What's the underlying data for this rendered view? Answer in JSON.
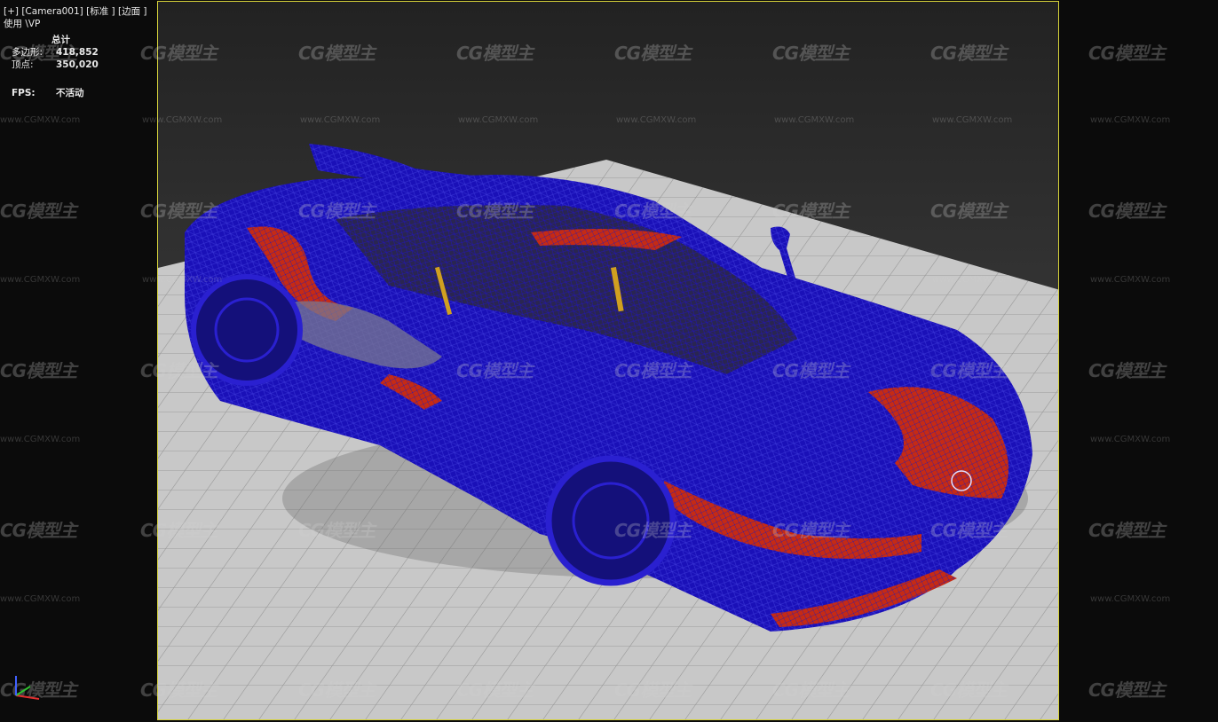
{
  "viewport": {
    "label_line1": "[+] [Camera001] [标准 ] [边面 ]",
    "label_line2": "使用 \\VP"
  },
  "stats": {
    "header": "总计",
    "polys_label": "多边形:",
    "polys_value": "418,852",
    "verts_label": "顶点:",
    "verts_value": "350,020",
    "fps_label": "FPS:",
    "fps_value": "不活动"
  },
  "watermark": {
    "logo_text": "CG模型主",
    "url_text": "www.CGMXW.com"
  },
  "colors": {
    "frame_border": "#d6d23a",
    "wire_blue": "#1a10b8",
    "body_red": "#c62a14",
    "floor": "#c8c8c8"
  },
  "icons": {
    "axis_gizmo": "xyz-axis-gizmo-icon"
  }
}
